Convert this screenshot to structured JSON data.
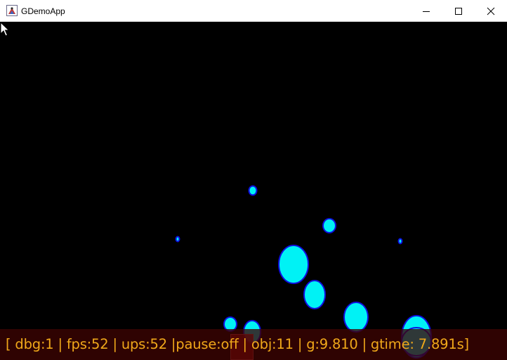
{
  "window": {
    "title": "GDemoApp"
  },
  "scene": {
    "ball_color": "#00f2f5",
    "ball_outline_color": "#1010e0",
    "background_color": "#000000"
  },
  "status": {
    "text": "[ dbg:1 | fps:52 | ups:52 |pause:off | obj:11 | g:9.810 | gtime: 7.891s]"
  },
  "colors": {
    "status_text": "#f0a81a",
    "status_bg": "#3c0402",
    "marker": "#c80c0c"
  }
}
